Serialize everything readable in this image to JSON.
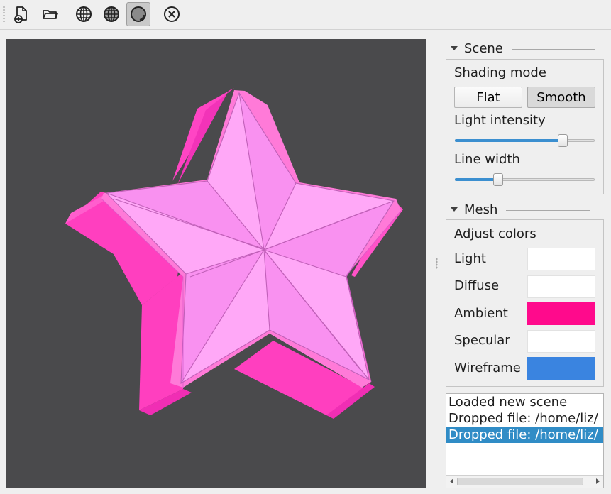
{
  "toolbar": {
    "buttons": [
      {
        "id": "new",
        "icon": "new-file-icon"
      },
      {
        "id": "open",
        "icon": "folder-open-icon"
      },
      {
        "id": "wireframe",
        "icon": "globe-wireframe-icon"
      },
      {
        "id": "wireframe-shaded",
        "icon": "globe-shaded-icon"
      },
      {
        "id": "shaded",
        "icon": "sphere-shaded-icon",
        "checked": true
      },
      {
        "id": "close",
        "icon": "close-circle-icon"
      }
    ]
  },
  "viewport": {
    "background": "#4a4a4c",
    "model": "star-mesh-icon"
  },
  "scene": {
    "title": "Scene",
    "shading_label": "Shading mode",
    "flat_label": "Flat",
    "smooth_label": "Smooth",
    "active_shading": "Smooth",
    "light_intensity_label": "Light intensity",
    "light_intensity_value": 0.77,
    "line_width_label": "Line width",
    "line_width_value": 0.31
  },
  "mesh": {
    "title": "Mesh",
    "adjust_label": "Adjust colors",
    "colors": [
      {
        "label": "Light",
        "color": "#ffffff"
      },
      {
        "label": "Diffuse",
        "color": "#ffffff"
      },
      {
        "label": "Ambient",
        "color": "#ff0a8c"
      },
      {
        "label": "Specular",
        "color": "#ffffff"
      },
      {
        "label": "Wireframe",
        "color": "#3a84e0"
      }
    ]
  },
  "log": {
    "lines": [
      "Loaded new scene",
      "Dropped file: /home/liz/",
      "Dropped file: /home/liz/"
    ],
    "selected_index": 2
  },
  "colors": {
    "accent": "#308cc6",
    "slider_fill": "#3b8fd0"
  }
}
